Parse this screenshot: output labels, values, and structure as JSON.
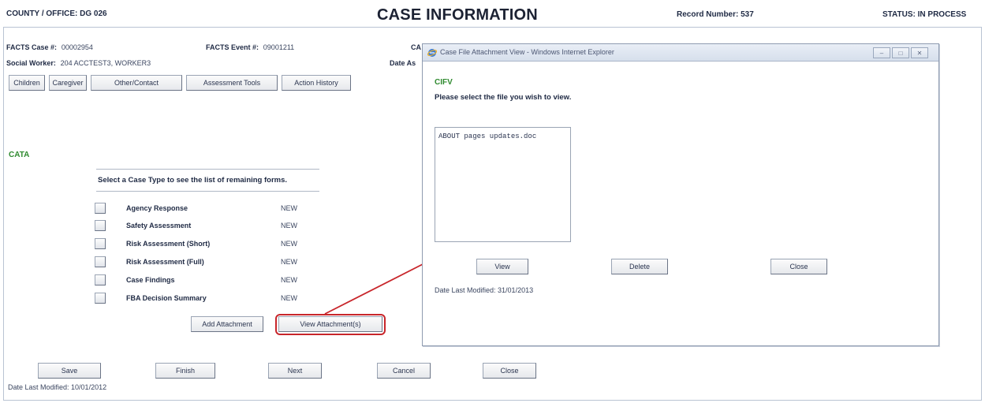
{
  "header": {
    "county_office": "COUNTY / OFFICE: DG 026",
    "title": "CASE INFORMATION",
    "record_number": "Record Number: 537",
    "status": "STATUS: IN PROCESS"
  },
  "case": {
    "facts_case_label": "FACTS Case #:",
    "facts_case_value": "00002954",
    "facts_event_label": "FACTS Event #:",
    "facts_event_value": "09001211",
    "cps_label": "CA",
    "social_worker_label": "Social Worker:",
    "social_worker_value": "204 ACCTEST3, WORKER3",
    "date_assigned_label": "Date As"
  },
  "tabs": [
    "Children",
    "Caregiver",
    "Other/Contact",
    "Assessment Tools",
    "Action History"
  ],
  "section_label": "CATA",
  "case_type_prompt": "Select a Case Type to see the list of remaining forms.",
  "forms": [
    {
      "label": "Agency Response",
      "status": "NEW"
    },
    {
      "label": "Safety Assessment",
      "status": "NEW"
    },
    {
      "label": "Risk Assessment (Short)",
      "status": "NEW"
    },
    {
      "label": "Risk Assessment (Full)",
      "status": "NEW"
    },
    {
      "label": "Case Findings",
      "status": "NEW"
    },
    {
      "label": "FBA Decision Summary",
      "status": "NEW"
    }
  ],
  "attachments": {
    "add_label": "Add Attachment",
    "view_label": "View Attachment(s)"
  },
  "bottom_buttons": {
    "save": "Save",
    "finish": "Finish",
    "next": "Next",
    "cancel": "Cancel",
    "close": "Close"
  },
  "date_last_modified": "Date Last Modified: 10/01/2012",
  "popup": {
    "window_title": "Case File Attachment View - Windows Internet Explorer",
    "section_code": "CIFV",
    "prompt": "Please select the file you wish to view.",
    "files": [
      "ABOUT pages updates.doc"
    ],
    "view_label": "View",
    "delete_label": "Delete",
    "close_label": "Close",
    "date_last_modified": "Date Last Modified: 31/01/2013"
  },
  "colors": {
    "section_green": "#2f8a2f",
    "callout_red": "#c8262b"
  }
}
